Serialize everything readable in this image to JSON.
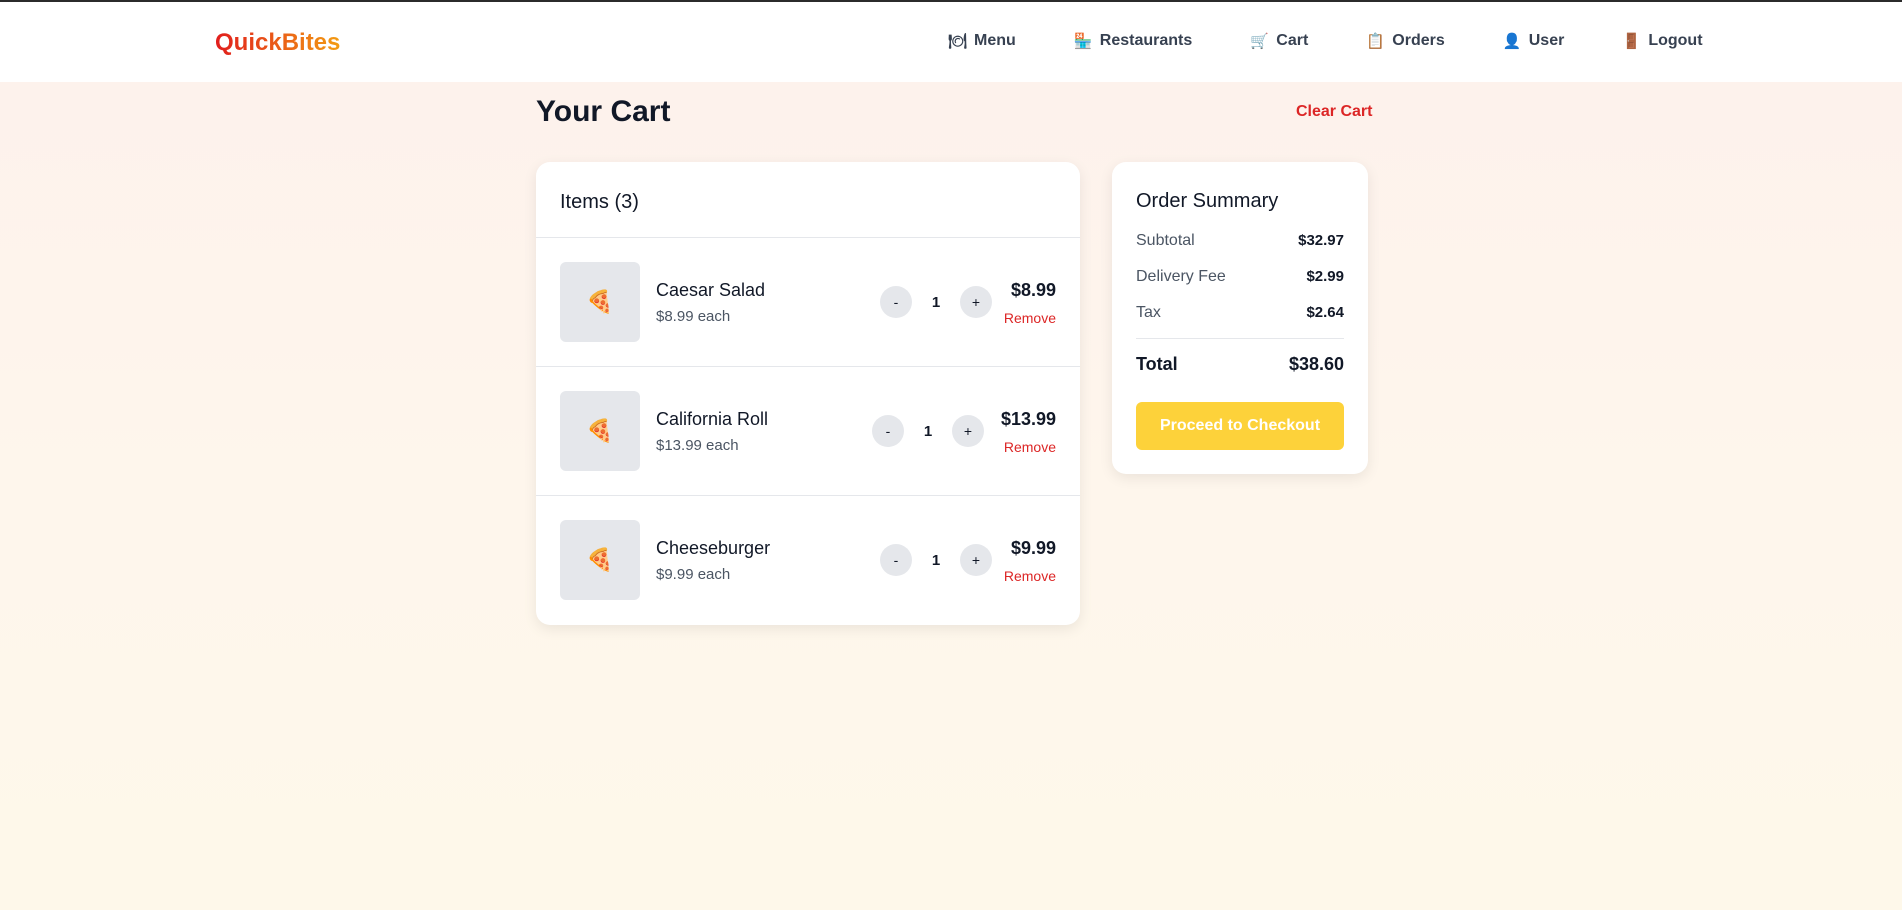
{
  "brand": {
    "name": "QuickBites"
  },
  "nav": [
    {
      "icon": "menu-icon",
      "glyph": "🍽",
      "label": "Menu"
    },
    {
      "icon": "restaurant-icon",
      "glyph": "🏪",
      "label": "Restaurants"
    },
    {
      "icon": "cart-icon",
      "glyph": "🛒",
      "label": "Cart"
    },
    {
      "icon": "orders-icon",
      "glyph": "📋",
      "label": "Orders"
    },
    {
      "icon": "user-icon",
      "glyph": "👤",
      "label": "User"
    },
    {
      "icon": "logout-icon",
      "glyph": "🚪",
      "label": "Logout"
    }
  ],
  "cart": {
    "title": "Your Cart",
    "clear_label": "Clear Cart",
    "items_header": "Items (3)",
    "items": [
      {
        "name": "Caesar Salad",
        "each": "$8.99 each",
        "qty": "1",
        "price": "$8.99",
        "remove": "Remove",
        "minus": "-",
        "plus": "+",
        "thumb_icon": "pizza-icon",
        "thumb_glyph": "🍕"
      },
      {
        "name": "California Roll",
        "each": "$13.99 each",
        "qty": "1",
        "price": "$13.99",
        "remove": "Remove",
        "minus": "-",
        "plus": "+",
        "thumb_icon": "pizza-icon",
        "thumb_glyph": "🍕"
      },
      {
        "name": "Cheeseburger",
        "each": "$9.99 each",
        "qty": "1",
        "price": "$9.99",
        "remove": "Remove",
        "minus": "-",
        "plus": "+",
        "thumb_icon": "pizza-icon",
        "thumb_glyph": "🍕"
      }
    ]
  },
  "summary": {
    "title": "Order Summary",
    "subtotal_label": "Subtotal",
    "subtotal": "$32.97",
    "delivery_label": "Delivery Fee",
    "delivery": "$2.99",
    "tax_label": "Tax",
    "tax": "$2.64",
    "total_label": "Total",
    "total": "$38.60",
    "checkout_label": "Proceed to Checkout"
  },
  "colors": {
    "accent": "#fdd23a",
    "danger": "#dc2626",
    "brand_start": "#e11d1d",
    "brand_end": "#f39c12"
  }
}
